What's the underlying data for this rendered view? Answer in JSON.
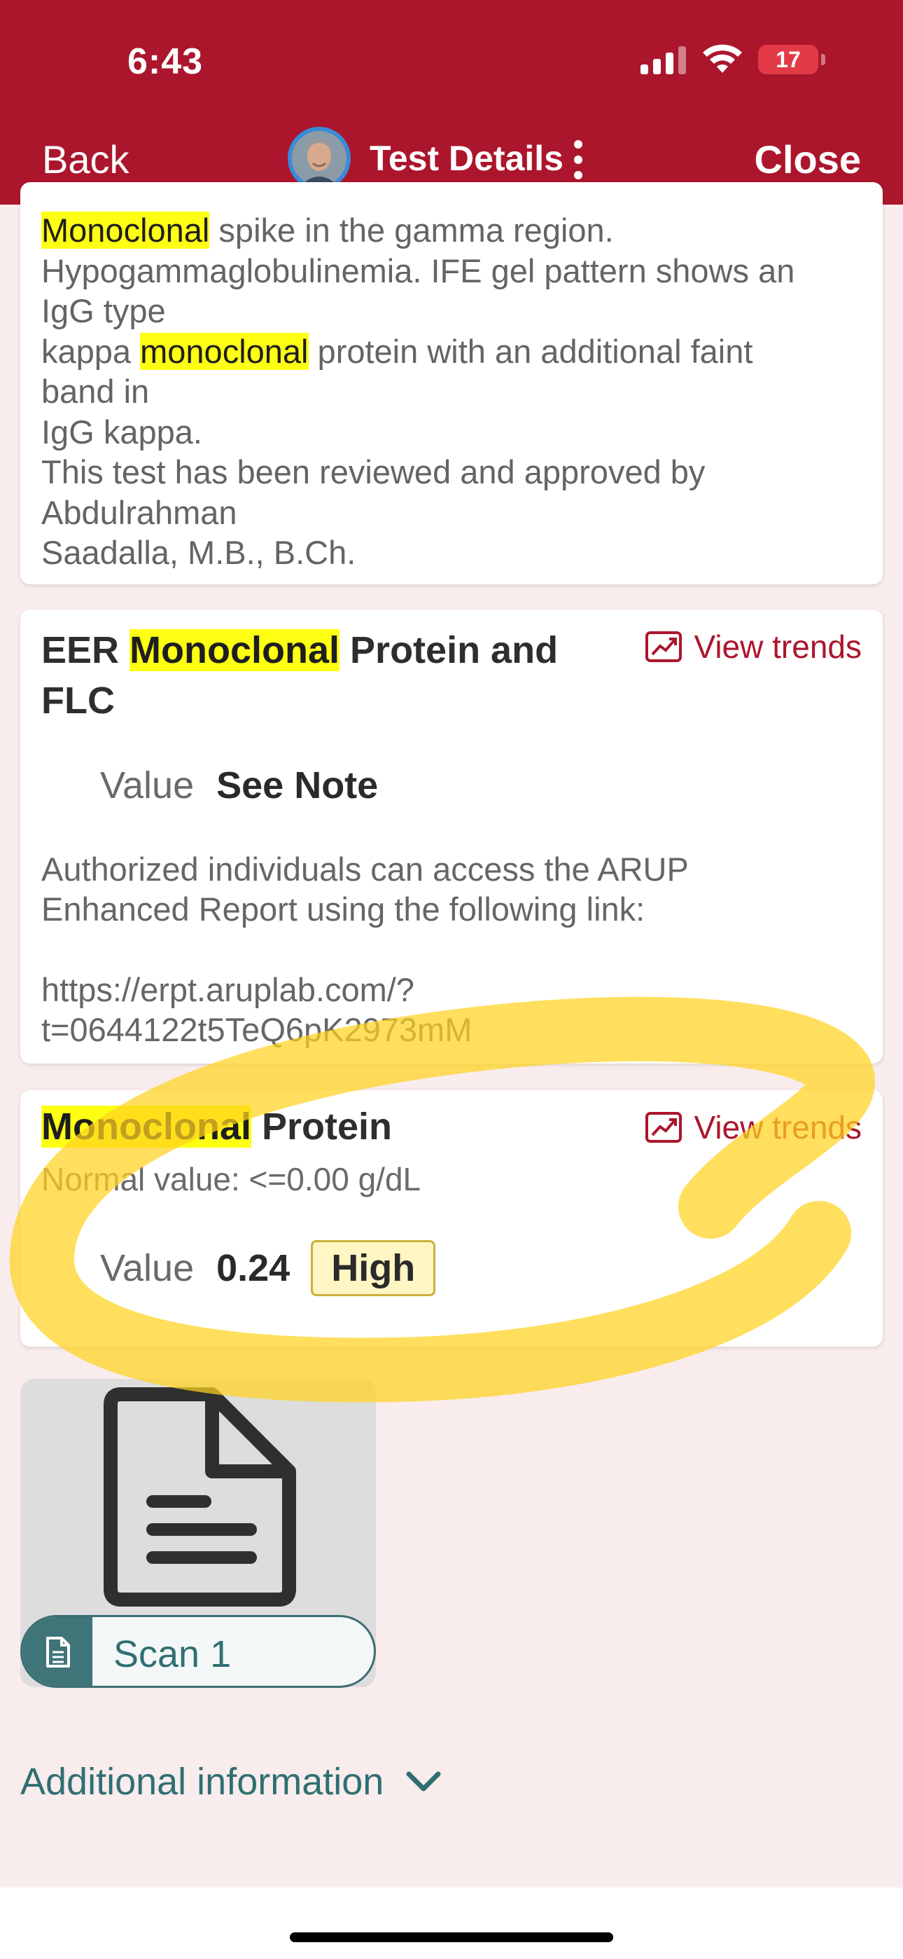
{
  "status_bar": {
    "time": "6:43",
    "battery": "17"
  },
  "nav": {
    "back_label": "Back",
    "title": "Test Details",
    "close_label": "Close"
  },
  "report_card": {
    "lines": [
      {
        "hl": "Monoclonal",
        "rest": " spike in the gamma region."
      },
      {
        "hl": "",
        "rest": "Hypogammaglobulinemia. IFE gel pattern shows an"
      },
      {
        "hl": "",
        "rest": "IgG type"
      },
      {
        "pre": "kappa ",
        "hl": "monoclonal",
        "rest": " protein with an additional faint"
      },
      {
        "hl": "",
        "rest": "band in"
      },
      {
        "hl": "",
        "rest": "IgG kappa."
      },
      {
        "hl": "",
        "rest": "This test has been reviewed and approved by"
      },
      {
        "hl": "",
        "rest": "Abdulrahman"
      },
      {
        "hl": "",
        "rest": "Saadalla, M.B., B.Ch."
      }
    ]
  },
  "eer_card": {
    "title_pre": "EER ",
    "title_hl": "Monoclonal",
    "title_post": " Protein and",
    "title_line2": "FLC",
    "trends_label": "View trends",
    "value_label": "Value",
    "value": "See Note",
    "note_line1": "Authorized individuals can access the ARUP",
    "note_line2": "Enhanced Report using the following link:",
    "link_line1": "https://erpt.aruplab.com/?",
    "link_line2": "t=0644122t5TeQ6pK2973mM"
  },
  "protein_card": {
    "title_hl": "Monoclonal",
    "title_post": " Protein",
    "trends_label": "View trends",
    "normal_value": "Normal value: <=0.00 g/dL",
    "value_label": "Value",
    "value": "0.24",
    "flag": "High"
  },
  "scan": {
    "label": "Scan 1"
  },
  "additional": {
    "label": "Additional information"
  },
  "colors": {
    "header": "#ab162d",
    "accent_teal": "#2f6f72",
    "highlight": "#ffff14",
    "annotation": "#ffd21f"
  }
}
